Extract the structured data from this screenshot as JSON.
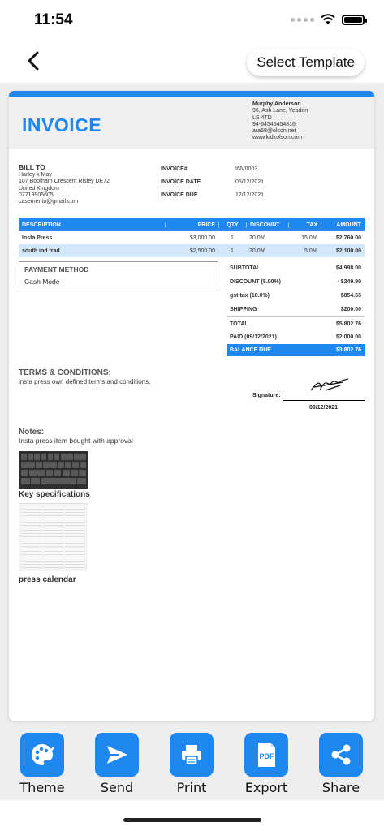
{
  "status": {
    "time": "11:54"
  },
  "nav": {
    "select_template": "Select Template"
  },
  "invoice": {
    "title": "INVOICE",
    "company": {
      "name": "Murphy Anderson",
      "address1": "96, Ash Lane, Yeadon",
      "address2": "LS 4TD",
      "phone": "94-64545454816",
      "email": "ara58@olson.net",
      "website": "www.kidzolson.com"
    },
    "bill_to": {
      "label": "BILL TO",
      "name": "Harley k May",
      "address": "107 Bootham Crescent Risley DE72",
      "country": "United Kingdom",
      "phone": "07719905605",
      "email": "casemento@gmail.com"
    },
    "meta": [
      {
        "key": "INVOICE#",
        "value": "INV0003"
      },
      {
        "key": "INVOICE DATE",
        "value": "05/12/2021"
      },
      {
        "key": "INVOICE DUE",
        "value": "12/12/2021"
      }
    ],
    "table_headers": {
      "desc": "DESCRIPTION",
      "price": "PRICE",
      "qty": "QTY",
      "discount": "DISCOUNT",
      "tax": "TAX",
      "amount": "AMOUNT"
    },
    "items": [
      {
        "desc": "Insta Press",
        "price": "$3,000.00",
        "qty": "1",
        "discount": "20.0%",
        "tax": "15.0%",
        "amount": "$2,760.00"
      },
      {
        "desc": "south ind trad",
        "price": "$2,500.00",
        "qty": "1",
        "discount": "20.0%",
        "tax": "5.0%",
        "amount": "$2,100.00"
      }
    ],
    "payment": {
      "label": "PAYMENT METHOD",
      "value": "Cash Mode"
    },
    "totals": [
      {
        "key": "SUBTOTAL",
        "value": "$4,998.00"
      },
      {
        "key": "DISCOUNT (5.00%)",
        "value": "- $249.90"
      },
      {
        "key": "gst tax (18.0%)",
        "value": "$854.66"
      },
      {
        "key": "SHIPPING",
        "value": "$200.00"
      },
      {
        "key": "TOTAL",
        "value": "$5,802.76"
      },
      {
        "key": "PAID (09/12/2021)",
        "value": "$2,000.00"
      },
      {
        "key": "BALANCE DUE",
        "value": "$3,802.76"
      }
    ],
    "terms": {
      "label": "TERMS & CONDITIONS:",
      "text": "insta press own defined terms and conditions."
    },
    "signature": {
      "label": "Signature:",
      "date": "09/12/2021"
    },
    "notes": {
      "label": "Notes:",
      "text": "Insta press item bought with approval"
    },
    "attachments": [
      {
        "caption": "Key specifications"
      },
      {
        "caption": "press calendar"
      }
    ]
  },
  "toolbar": [
    {
      "label": "Theme",
      "icon": "palette-icon"
    },
    {
      "label": "Send",
      "icon": "send-icon"
    },
    {
      "label": "Print",
      "icon": "printer-icon"
    },
    {
      "label": "Export",
      "icon": "pdf-icon"
    },
    {
      "label": "Share",
      "icon": "share-icon"
    }
  ],
  "colors": {
    "accent": "#1e88f0",
    "row_alt": "#d3e7fb"
  }
}
